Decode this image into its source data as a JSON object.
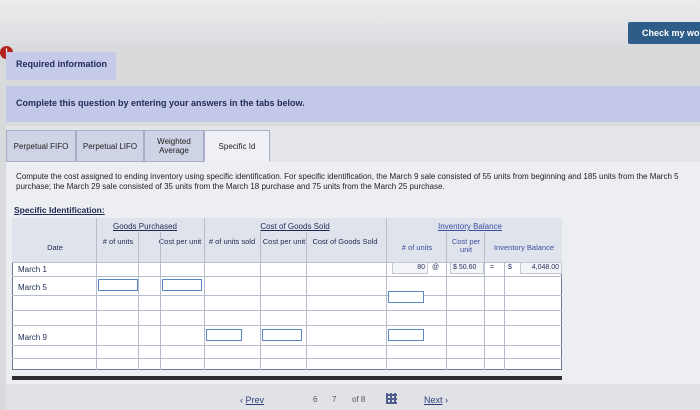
{
  "header": {
    "check_label": "Check my wor"
  },
  "alert": {
    "icon_text": "!"
  },
  "required_info": {
    "label": "Required information"
  },
  "instructions": {
    "text": "Complete this question by entering your answers in the tabs below."
  },
  "tabs": [
    {
      "label": "Perpetual FIFO"
    },
    {
      "label": "Perpetual LIFO"
    },
    {
      "label": "Weighted Average"
    },
    {
      "label": "Specific Id"
    }
  ],
  "prompt": "Compute the cost assigned to ending inventory using specific identification. For specific identification, the March 9 sale consisted of 55 units from beginning and 185 units from the March 5 purchase; the March 29 sale consisted of 35 units from the March 18 purchase and 75 units from the March 25 purchase.",
  "table": {
    "title": "Specific Identification:",
    "groups": {
      "purchased": "Goods Purchased",
      "cogs": "Cost of Goods Sold",
      "inventory": "Inventory Balance"
    },
    "headers": {
      "date": "Date",
      "units_purchased": "# of units",
      "cost_per_unit_purchased": "Cost per unit",
      "units_sold": "# of units sold",
      "cost_per_unit_sold": "Cost per unit",
      "cogs": "Cost of Goods Sold",
      "units_inv": "# of units",
      "cost_per_unit_inv": "Cost per unit",
      "inv_balance": "Inventory Balance"
    },
    "rows": [
      {
        "date": "March 1",
        "units_inv": "80",
        "at": "@",
        "cost_inv": "$ 50.60",
        "eq": "=",
        "dollar": "$",
        "balance": "4,048.00"
      },
      {
        "date": "March 5"
      },
      {
        "date": "March 9"
      }
    ]
  },
  "nav": {
    "prev": "Prev",
    "page_6": "6",
    "page_7": "7",
    "of": "of 8",
    "next": "Next"
  }
}
